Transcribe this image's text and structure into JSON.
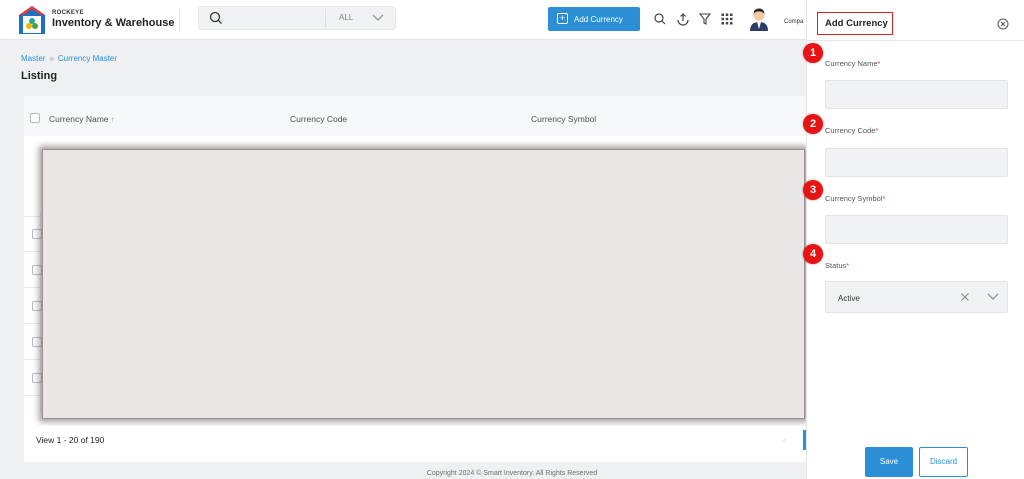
{
  "brand": {
    "small": "ROCKEYE",
    "name": "Inventory & Warehouse"
  },
  "search": {
    "filter": "ALL"
  },
  "header": {
    "add_button": "Add Currency",
    "user_text": "Compa"
  },
  "breadcrumb": {
    "root": "Master",
    "current": "Currency Master"
  },
  "page": {
    "title": "Listing"
  },
  "table": {
    "columns": [
      "Currency Name",
      "Currency Code",
      "Currency Symbol"
    ],
    "sort_indicator": "↑"
  },
  "pagination": {
    "view_text": "View 1 - 20 of 190",
    "prev": "‹"
  },
  "footer": {
    "copyright": "Copyright 2024 © Smart Inventory. All Rights Reserved"
  },
  "panel": {
    "title": "Add Currency",
    "fields": [
      {
        "badge": "1",
        "label": "Currency Name",
        "required": "*"
      },
      {
        "badge": "2",
        "label": "Currency Code",
        "required": "*"
      },
      {
        "badge": "3",
        "label": "Currency Symbol",
        "required": "*"
      },
      {
        "badge": "4",
        "label": "Status",
        "required": "*"
      }
    ],
    "status_value": "Active",
    "save": "Save",
    "discard": "Discard"
  },
  "colors": {
    "primary": "#2c8fd6",
    "badge": "#e81313",
    "highlight": "#d42525"
  }
}
